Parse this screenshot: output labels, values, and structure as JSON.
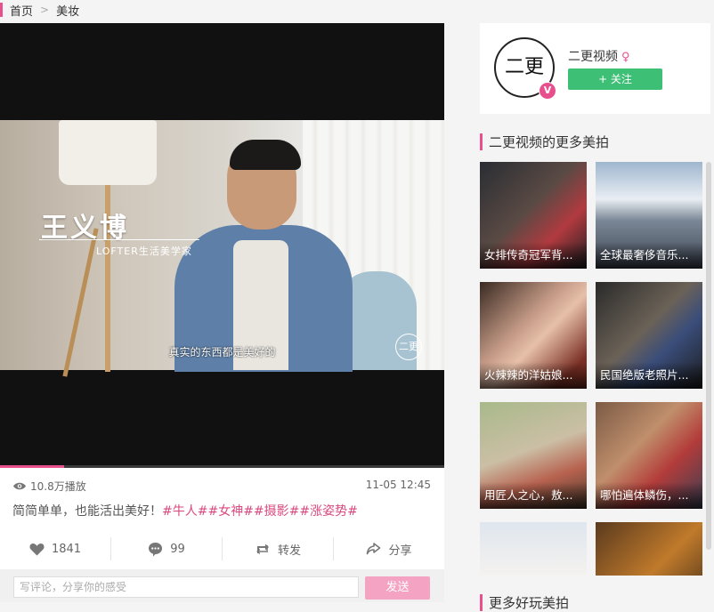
{
  "breadcrumb": {
    "home": "首页",
    "current": "美妆"
  },
  "video": {
    "overlay_name": "王义博",
    "overlay_role": "LOFTER生活美学家",
    "subtitle": "真实的东西都是美好的",
    "watermark": "二更",
    "progress": 0.145
  },
  "post": {
    "views": "10.8万播放",
    "date": "11-05 12:45",
    "text": "简简单单，也能活出美好！",
    "tags": "#牛人##女神##摄影##涨姿势#"
  },
  "actions": {
    "like_count": "1841",
    "comment_count": "99",
    "repost_label": "转发",
    "share_label": "分享"
  },
  "comment": {
    "placeholder": "写评论，分享你的感受",
    "send_label": "发送"
  },
  "author": {
    "name": "二更视频",
    "gender_symbol": "♀",
    "avatar_text": "二更",
    "verified_badge": "V",
    "follow_label": "+ 关注"
  },
  "more_section_title": "二更视频的更多美拍",
  "more_videos": [
    {
      "title": "女排传奇冠军背...",
      "bg": "linear-gradient(135deg,#2a2d33,#5a4a44 45%,#b13a3f 70%,#1f1f22)"
    },
    {
      "title": "全球最奢侈音乐...",
      "bg": "linear-gradient(180deg,#9fb6cf 0%,#e9eef3 35%,#7a8796 55%,#3e4653 100%)"
    },
    {
      "title": "火辣辣的洋姑娘...",
      "bg": "linear-gradient(135deg,#3a2a22,#c49a86 40%,#e7c0a9 55%,#7a2f24 85%)"
    },
    {
      "title": "民国绝版老照片...",
      "bg": "linear-gradient(135deg,#2a2a2a,#6b6257 45%,#3a4d7a 65%,#1c1c1c)"
    },
    {
      "title": "用匠人之心，敖...",
      "bg": "linear-gradient(160deg,#a8b98a,#cbbfa5 45%,#b7624f 70%,#4b3a2c)"
    },
    {
      "title": "哪怕遍体鳞伤，...",
      "bg": "linear-gradient(135deg,#7b5a45,#c08f6c 40%,#b33c3a 65%,#3a3f54)"
    },
    {
      "title": "",
      "bg": "linear-gradient(180deg,#dfe6ee,#f4f2ef 50%,#e8c9b5)"
    },
    {
      "title": "",
      "bg": "linear-gradient(135deg,#5a3a1e,#c07a2b 50%,#2d2016)"
    }
  ],
  "bottom_section_title": "更多好玩美拍",
  "colors": {
    "accent_pink": "#e8508d",
    "follow_green": "#3ebf76",
    "send_pink": "#f4a3c3"
  }
}
